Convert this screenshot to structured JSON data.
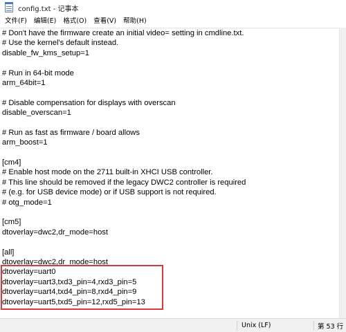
{
  "window": {
    "title": "config.txt - 记事本",
    "icon": "notepad-icon"
  },
  "menu": {
    "items": [
      "文件(F)",
      "编辑(E)",
      "格式(O)",
      "查看(V)",
      "帮助(H)"
    ]
  },
  "editor": {
    "lines": [
      "# Don't have the firmware create an initial video= setting in cmdline.txt.",
      "# Use the kernel's default instead.",
      "disable_fw_kms_setup=1",
      "",
      "# Run in 64-bit mode",
      "arm_64bit=1",
      "",
      "# Disable compensation for displays with overscan",
      "disable_overscan=1",
      "",
      "# Run as fast as firmware / board allows",
      "arm_boost=1",
      "",
      "[cm4]",
      "# Enable host mode on the 2711 built-in XHCI USB controller.",
      "# This line should be removed if the legacy DWC2 controller is required",
      "# (e.g. for USB device mode) or if USB support is not required.",
      "# otg_mode=1",
      "",
      "[cm5]",
      "dtoverlay=dwc2,dr_mode=host",
      "",
      "[all]",
      "dtoverlay=dwc2,dr_mode=host",
      "dtoverlay=uart0",
      "dtoverlay=uart3,txd3_pin=4,rxd3_pin=5",
      "dtoverlay=uart4,txd4_pin=8,rxd4_pin=9",
      "dtoverlay=uart5,txd5_pin=12,rxd5_pin=13"
    ],
    "highlight_color": "#d63a3a"
  },
  "status": {
    "line_ending": "Unix (LF)",
    "position": "第 53 行"
  }
}
